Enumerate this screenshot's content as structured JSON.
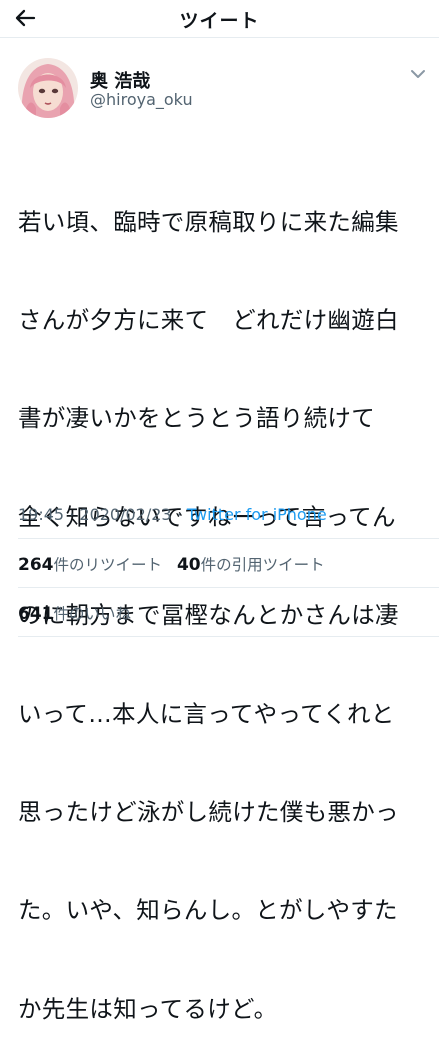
{
  "header": {
    "title": "ツイート",
    "back_icon": "arrow-left-icon"
  },
  "author": {
    "name": "奥 浩哉",
    "handle": "@hiroya_oku",
    "avatar_icon": "avatar-illustration",
    "more_icon": "chevron-down-icon"
  },
  "tweet": {
    "lines": [
      "若い頃、臨時で原稿取りに来た編集",
      "さんが夕方に来て　どれだけ幽遊白",
      "書が凄いかをとうとう語り続けて",
      "全く知らないですねーって言ってん",
      "のに朝方まで冨樫なんとかさんは凄",
      "いって…本人に言ってやってくれと",
      "思ったけど泳がし続けた僕も悪かっ",
      "た。いや、知らんし。とがしやすた",
      "か先生は知ってるけど。"
    ]
  },
  "meta": {
    "time": "19:45",
    "separator": "·",
    "date": "2020/02/23",
    "source": "Twitter for iPhone"
  },
  "stats": {
    "retweets": {
      "count": "264",
      "label": "件のリツイート"
    },
    "quotes": {
      "count": "40",
      "label": "件の引用ツイート"
    },
    "likes": {
      "count": "641",
      "label": "件のいいね"
    }
  },
  "colors": {
    "link": "#1d9bf0",
    "secondary": "#536471",
    "text": "#0f1419",
    "divider": "#e6ecf0"
  }
}
